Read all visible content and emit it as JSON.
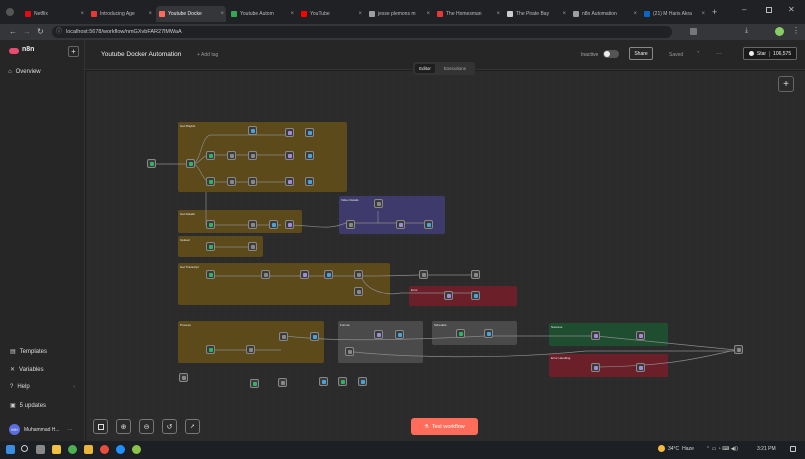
{
  "browser": {
    "tabs": [
      {
        "label": "Netflix",
        "color": "#e50914"
      },
      {
        "label": "Introducing Age",
        "color": "#e53935"
      },
      {
        "label": "Youtube Docke",
        "color": "#ff6d5a"
      },
      {
        "label": "Youtube Autom",
        "color": "#34a853"
      },
      {
        "label": "YouTube",
        "color": "#ff0000"
      },
      {
        "label": "jesse plemons m",
        "color": "#9e9e9e"
      },
      {
        "label": "The Homesman",
        "color": "#e53935"
      },
      {
        "label": "The Pirate Bay",
        "color": "#cccccc"
      },
      {
        "label": "n8n Automation",
        "color": "#9e9e9e"
      },
      {
        "label": "(21) M Haris Akra",
        "color": "#0a66c2"
      }
    ],
    "url": "localhost:5678/workflow/nmGXvbFAR27lMWaA"
  },
  "sidebar": {
    "logo": "n8n",
    "add_label": "+",
    "overview": "Overview",
    "templates": "Templates",
    "variables": "Variables",
    "help": "Help",
    "updates": "5 updates",
    "user_initials": "MH",
    "user_name": "Muhammad H..."
  },
  "header": {
    "workflow_title": "Youtube Docker Automation",
    "add_tag": "+ Add tag",
    "status": "Inactive",
    "share": "Share",
    "saved": "Saved",
    "more": "···",
    "star_label": "Star",
    "star_count": "106,575",
    "tabs": [
      "Editor",
      "Executions"
    ],
    "add_node": "+"
  },
  "canvas": {
    "test_button": "Test workflow",
    "sticky_labels": {
      "s1": "Get Playlist",
      "s2": "Get Details",
      "s3": "Video Details",
      "s4": "Upload",
      "s5": "Get Transcript",
      "s6": "Error",
      "s7": "Process",
      "s8": "Format",
      "s9": "Schedule",
      "s10": "Success",
      "s11": "Error Handling"
    }
  },
  "taskbar": {
    "weather": "34°C",
    "weather_desc": "Haze",
    "time": "3:21 PM"
  },
  "colors": {
    "accent": "#ea4b71",
    "sticky_yellow": "#5c4a1a",
    "sticky_purple": "#3e3a6b",
    "sticky_red": "#6b1f28",
    "sticky_gray": "#4a4a4a",
    "sticky_green": "#1f4d30",
    "test_button": "#ff6d5a"
  }
}
